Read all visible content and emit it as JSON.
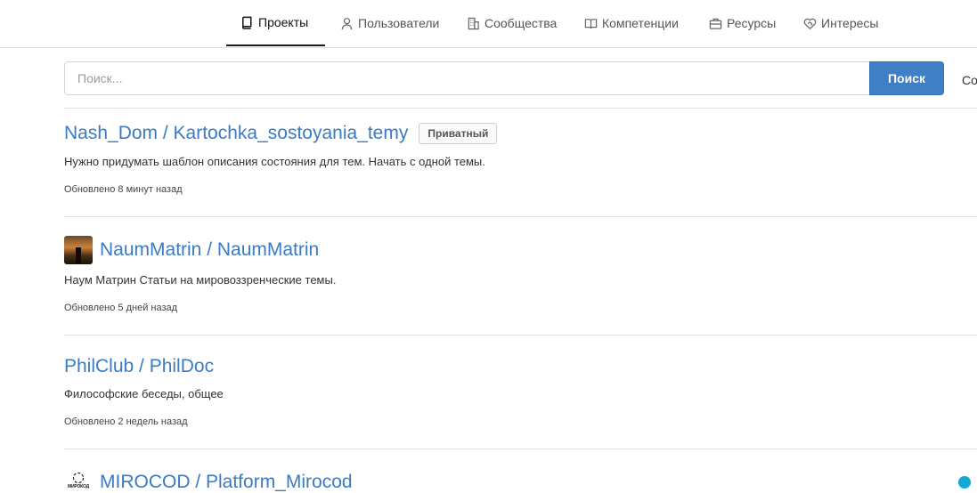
{
  "nav": {
    "tabs": [
      {
        "label": "Проекты",
        "icon": "book-icon",
        "active": true
      },
      {
        "label": "Пользователи",
        "icon": "user-icon",
        "active": false
      },
      {
        "label": "Сообщества",
        "icon": "building-icon",
        "active": false
      },
      {
        "label": "Компетенции",
        "icon": "open-book-icon",
        "active": false
      },
      {
        "label": "Ресурсы",
        "icon": "briefcase-icon",
        "active": false
      },
      {
        "label": "Интересы",
        "icon": "heart-handshake-icon",
        "active": false
      }
    ]
  },
  "search": {
    "placeholder": "Поиск...",
    "value": "",
    "button_label": "Поиск"
  },
  "sort": {
    "label": "Со"
  },
  "repos": [
    {
      "title": "Nash_Dom / Kartochka_sostoyania_temy",
      "badge": "Приватный",
      "description": "Нужно придумать шаблон описания состояния для тем. Начать с одной темы.",
      "updated": "Обновлено 8 минут назад"
    },
    {
      "title": "NaumMatrin / NaumMatrin",
      "description": "Наум Матрин Статьи на мировоззренческие темы.",
      "updated": "Обновлено 5 дней назад"
    },
    {
      "title": "PhilClub / PhilDoc",
      "description": "Философские беседы, общее",
      "updated": "Обновлено 2 недель назад"
    },
    {
      "title": "MIROCOD / Platform_Mirocod",
      "logo_text": "МИРОКОД"
    }
  ],
  "colors": {
    "link": "#3a7bc4",
    "primary_button": "#3f7fc5",
    "status_dot": "#12a8d8"
  }
}
